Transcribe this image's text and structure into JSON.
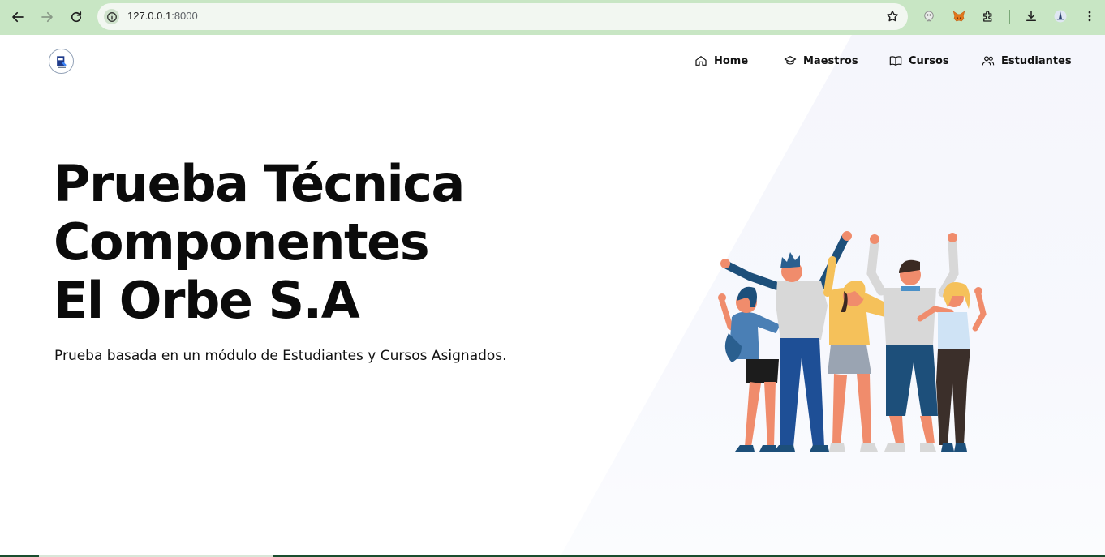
{
  "browser": {
    "url_host": "127.0.0.1",
    "url_port": ":8000"
  },
  "nav": {
    "items": [
      {
        "label": "Home",
        "icon": "home-icon"
      },
      {
        "label": "Maestros",
        "icon": "graduation-cap-icon"
      },
      {
        "label": "Cursos",
        "icon": "book-icon"
      },
      {
        "label": "Estudiantes",
        "icon": "users-icon"
      }
    ]
  },
  "hero": {
    "title_lines": [
      "Prueba Técnica",
      "Componentes",
      "El Orbe S.A"
    ],
    "subtitle": "Prueba basada en un módulo de Estudiantes y Cursos Asignados."
  },
  "colors": {
    "chrome": "#c8e6c4",
    "omnibox": "#f2f7f1",
    "accent_panel": "#f5f6fc"
  }
}
